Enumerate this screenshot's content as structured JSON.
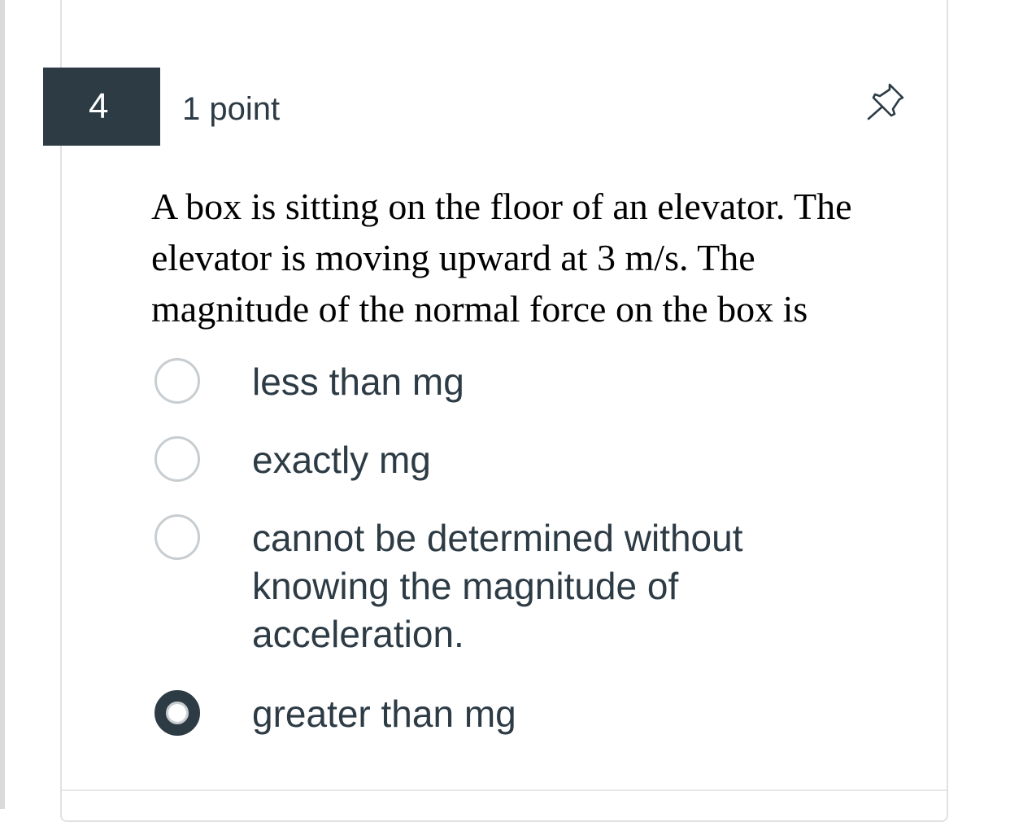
{
  "question": {
    "number": "4",
    "points": "1 point",
    "text": "A box is sitting on the floor of an elevator. The elevator is moving upward at 3 m/s. The magnitude of the normal force on the box is",
    "pin_icon": "pushpin-icon",
    "options": [
      {
        "label": "less than mg",
        "selected": false
      },
      {
        "label": "exactly mg",
        "selected": false
      },
      {
        "label": "cannot be determined without knowing the magnitude of acceleration.",
        "selected": false
      },
      {
        "label": "greater than mg",
        "selected": true
      }
    ]
  },
  "colors": {
    "header_bg": "#2d3b45",
    "text": "#2d3b45",
    "radio_border": "#c7cdd1"
  }
}
